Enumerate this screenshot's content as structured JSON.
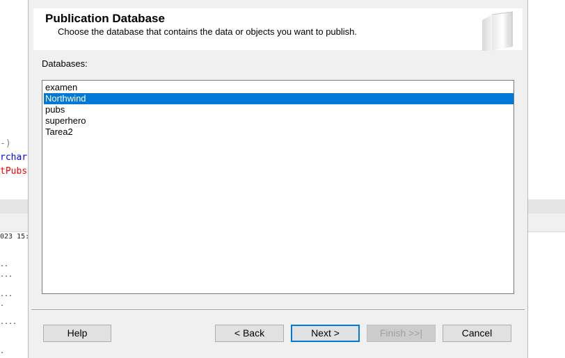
{
  "background": {
    "code_lines": [
      {
        "text": "-)",
        "color": "#808080"
      },
      {
        "text": "rchar",
        "color": "#0000ff"
      },
      {
        "text": "tPubs",
        "color": "#ff0000"
      }
    ],
    "log_lines": [
      "023 15:",
      "..",
      "...",
      "...",
      ".",
      "....",
      "."
    ]
  },
  "dialog": {
    "title": "Publication Database",
    "subtitle": "Choose the database that contains the data or objects you want to publish.",
    "list_label": "Databases:",
    "databases": [
      "examen",
      "Northwind",
      "pubs",
      "superhero",
      "Tarea2"
    ],
    "selected_database": "Northwind",
    "buttons": {
      "help": "Help",
      "back": "< Back",
      "next": "Next >",
      "finish": "Finish >>|",
      "cancel": "Cancel"
    }
  },
  "colors": {
    "selection": "#0078d7",
    "dialog_bg": "#f0f0f0"
  },
  "icons": {
    "header_graphic": "database-book-icon"
  }
}
